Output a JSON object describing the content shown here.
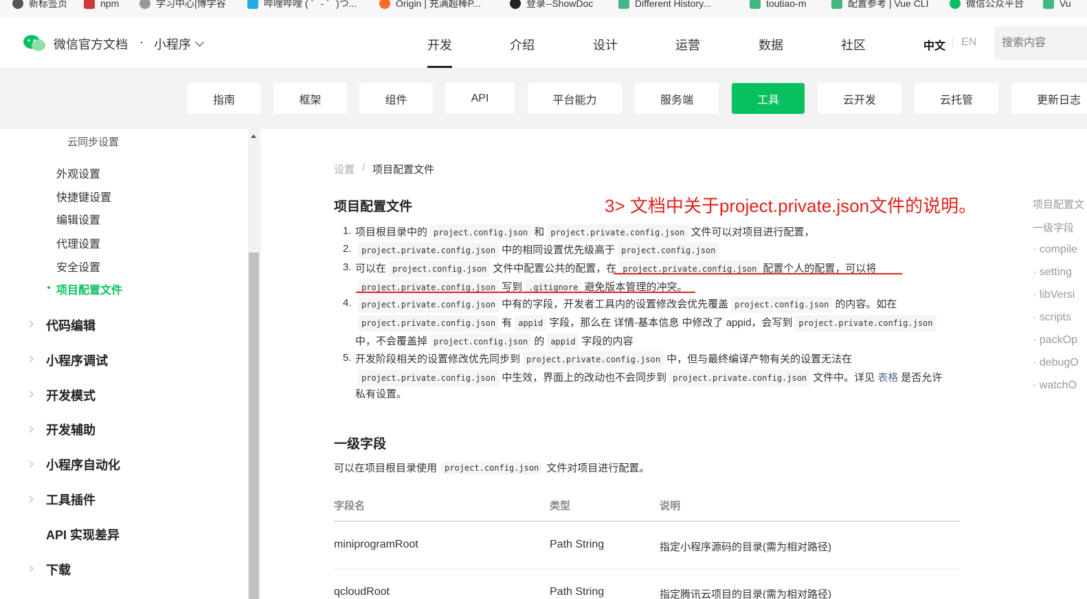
{
  "bookmarks": [
    {
      "label": "新标签页",
      "icon": "globe-icon",
      "color": "#555555"
    },
    {
      "label": "npm",
      "icon": "npm-icon",
      "color": "#cb3837"
    },
    {
      "label": "学习中心|博学谷",
      "icon": "cloud-icon",
      "color": "#999999"
    },
    {
      "label": "哔哩哔哩 ( ゜- ゜)つ...",
      "icon": "bilibili-icon",
      "color": "#23ade5"
    },
    {
      "label": "Origin | 充满超棒P...",
      "icon": "origin-icon",
      "color": "#f56c2d"
    },
    {
      "label": "登录--ShowDoc",
      "icon": "showdoc-icon",
      "color": "#222222"
    },
    {
      "label": "Different History...",
      "icon": "vue-icon",
      "color": "#41b883"
    },
    {
      "label": "toutiao-m",
      "icon": "vue-icon",
      "color": "#41b883"
    },
    {
      "label": "配置参考 | Vue CLI",
      "icon": "vue-icon",
      "color": "#41b883"
    },
    {
      "label": "微信公众平台",
      "icon": "wechat-icon",
      "color": "#07c160"
    },
    {
      "label": "Vu",
      "icon": "vue-icon",
      "color": "#41b883"
    }
  ],
  "header": {
    "brand": "微信官方文档",
    "dot": "·",
    "product": "小程序",
    "nav": [
      "开发",
      "介绍",
      "设计",
      "运营",
      "数据",
      "社区"
    ],
    "active_nav": "开发",
    "lang_zh": "中文",
    "lang_en": "EN",
    "search_placeholder": "搜索内容"
  },
  "subnav": {
    "items": [
      "指南",
      "框架",
      "组件",
      "API",
      "平台能力",
      "服务端",
      "工具",
      "云开发",
      "云托管",
      "更新日志"
    ],
    "active": "工具"
  },
  "sidebar": {
    "level3": [
      "云同步设置"
    ],
    "level2": [
      "外观设置",
      "快捷键设置",
      "编辑设置",
      "代理设置",
      "安全设置",
      "项目配置文件"
    ],
    "active": "项目配置文件",
    "level1": [
      "代码编辑",
      "小程序调试",
      "开发模式",
      "开发辅助",
      "小程序自动化",
      "工具插件",
      "API 实现差异",
      "下载"
    ]
  },
  "breadcrumb": {
    "parent": "设置",
    "sep": "/",
    "current": "项目配置文件"
  },
  "main": {
    "title": "项目配置文件",
    "annotation": "3> 文档中关于project.private.json文件的说明。",
    "list": {
      "n1": "1.",
      "n2": "2.",
      "n3": "3.",
      "n4": "4.",
      "n5": "5.",
      "i1": {
        "a": "项目根目录中的",
        "c1": "project.config.json",
        "b": "和",
        "c2": "project.private.config.json",
        "d": "文件可以对项目进行配置，"
      },
      "i2": {
        "c1": "project.private.config.json",
        "a": "中的相同设置优先级高于",
        "c2": "project.config.json"
      },
      "i3": {
        "a": "可以在",
        "c1": "project.config.json",
        "b": "文件中配置公共的配置，在",
        "c2": "project.private.config.json",
        "d": "配置个人的配置，可以将",
        "c3": "project.private.config.json",
        "e": "写到",
        "c4": ".gitignore",
        "f": "避免版本管理的冲突。"
      },
      "i4": {
        "c1": "project.private.config.json",
        "a": "中有的字段，开发者工具内的设置修改会优先覆盖",
        "c2": "project.config.json",
        "b": "的内容。如在",
        "c3": "project.private.config.json",
        "c": "有",
        "c4": "appid",
        "d": "字段，那么在 详情-基本信息 中修改了 appid，会写到",
        "c5": "project.private.config.json",
        "e": "中，不会覆盖掉",
        "c6": "project.config.json",
        "f": "的",
        "c7": "appid",
        "g": "字段的内容"
      },
      "i5": {
        "a": "开发阶段相关的设置修改优先同步到",
        "c1": "project.private.config.json",
        "b": "中，但与最终编译产物有关的设置无法在",
        "c2": "project.private.config.json",
        "c": "中生效，界面上的改动也不会同步到",
        "c3": "project.private.config.json",
        "d": "文件中。详见",
        "link": "表格",
        "e": "是否允许",
        "f": "私有设置。"
      }
    },
    "section2_title": "一级字段",
    "section2_intro": {
      "a": "可以在项目根目录使用",
      "code": "project.config.json",
      "b": "文件对项目进行配置。"
    },
    "table": {
      "headers": [
        "字段名",
        "类型",
        "说明"
      ],
      "rows": [
        [
          "miniprogramRoot",
          "Path String",
          "指定小程序源码的目录(需为相对路径)"
        ],
        [
          "qcloudRoot",
          "Path String",
          "指定腾讯云项目的目录(需为相对路径)"
        ]
      ]
    }
  },
  "toc": [
    "项目配置文",
    "一级字段",
    "· compile",
    "· setting",
    "· libVersi",
    "· scripts",
    "· packOp",
    "· debugO",
    "· watchO"
  ],
  "colors": {
    "accent": "#07c160",
    "annotation": "#e0201a",
    "link": "#576b95"
  }
}
